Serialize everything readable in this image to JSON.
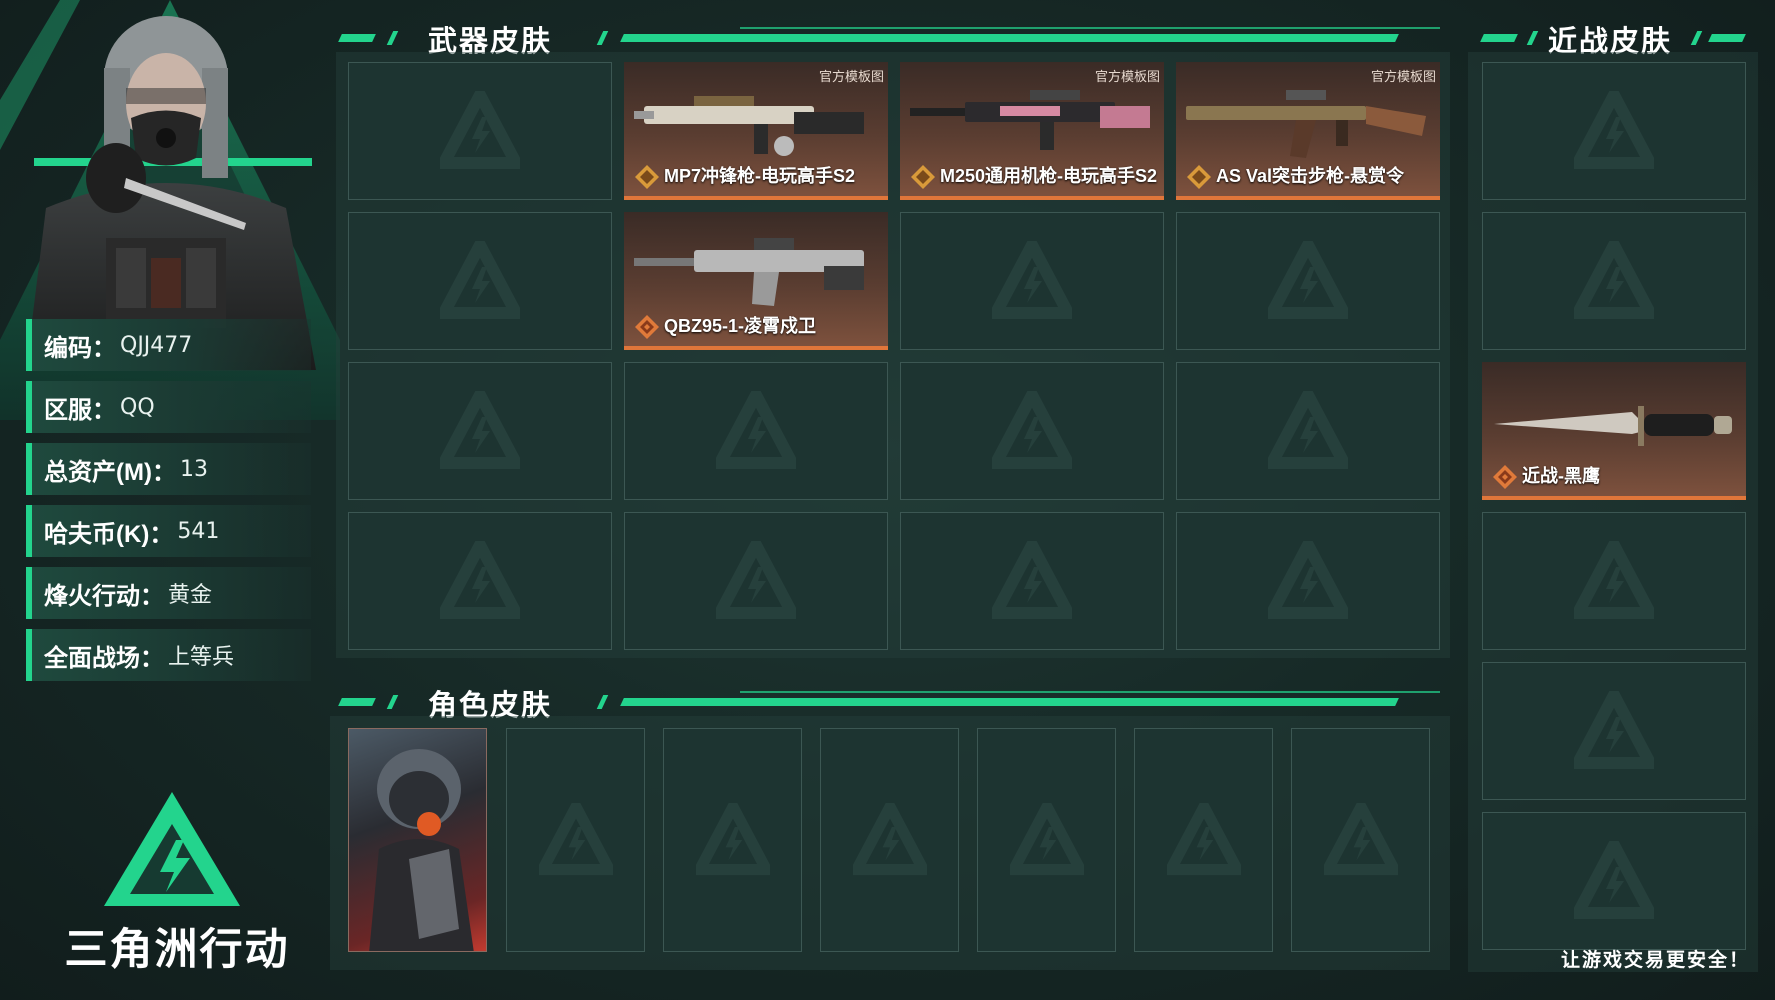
{
  "profile": {
    "fields": [
      {
        "label": "编码：",
        "value": "QJJ477"
      },
      {
        "label": "区服：",
        "value": "QQ"
      },
      {
        "label": "总资产(M)：",
        "value": "13"
      },
      {
        "label": "哈夫币(K)：",
        "value": "541"
      },
      {
        "label": "烽火行动：",
        "value": "黄金"
      },
      {
        "label": "全面战场：",
        "value": "上等兵"
      }
    ]
  },
  "brand": {
    "name": "三角洲行动"
  },
  "weapon_section": {
    "title": "武器皮肤",
    "items": [
      {
        "name": "MP7冲锋枪-电玩高手S2",
        "tag": "官方模板图",
        "rarity_icon": "legendary-badge-icon"
      },
      {
        "name": "M250通用机枪-电玩高手S2",
        "tag": "官方模板图",
        "rarity_icon": "legendary-badge-icon"
      },
      {
        "name": "AS Val突击步枪-悬赏令",
        "tag": "官方模板图",
        "rarity_icon": "legendary-badge-icon"
      },
      {
        "name": "QBZ95-1-凌霄戍卫",
        "tag": "",
        "rarity_icon": "rare-diamond-icon"
      }
    ]
  },
  "melee_section": {
    "title": "近战皮肤",
    "items": [
      {
        "name": "近战-黑鹰",
        "rarity_icon": "rare-diamond-icon"
      }
    ]
  },
  "character_section": {
    "title": "角色皮肤"
  },
  "footer": {
    "text": "让游戏交易更安全！"
  },
  "colors": {
    "accent": "#23d48d",
    "rarity_orange": "#e0763a",
    "cell_bg": "#1d3431"
  }
}
